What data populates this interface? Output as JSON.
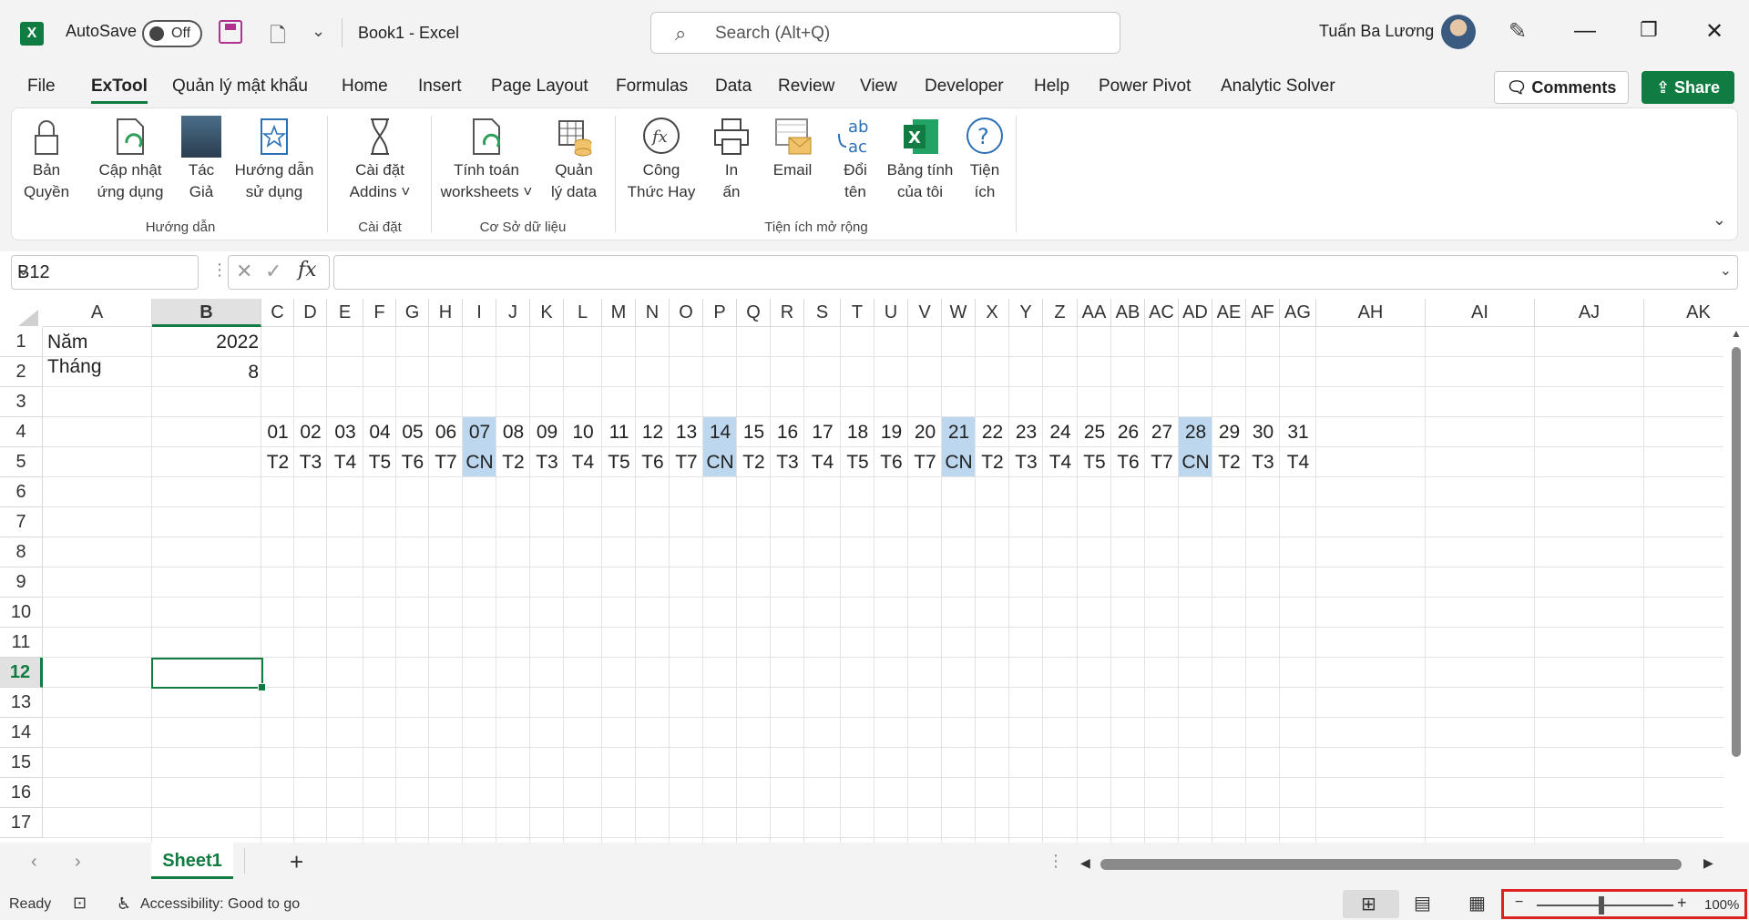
{
  "titlebar": {
    "autosave_label": "AutoSave",
    "autosave_state": "Off",
    "doc_title": "Book1  -  Excel",
    "search_placeholder": "Search (Alt+Q)",
    "user_name": "Tuấn Ba Lương"
  },
  "menu": {
    "items": [
      "File",
      "ExTool",
      "Quản lý mật khẩu",
      "Home",
      "Insert",
      "Page Layout",
      "Formulas",
      "Data",
      "Review",
      "View",
      "Developer",
      "Help",
      "Power Pivot",
      "Analytic Solver"
    ],
    "active": "ExTool",
    "comments_label": "Comments",
    "share_label": "Share"
  },
  "ribbon": {
    "groups": [
      {
        "label": "Hướng dẫn",
        "buttons": [
          {
            "line1": "Bản",
            "line2": "Quyền",
            "icon": "lock-icon"
          },
          {
            "line1": "Cập nhật",
            "line2": "ứng dụng",
            "icon": "update-icon"
          },
          {
            "line1": "Tác",
            "line2": "Giả",
            "icon": "author-photo-icon"
          },
          {
            "line1": "Hướng dẫn",
            "line2": "sử dụng",
            "icon": "guide-icon"
          }
        ]
      },
      {
        "label": "Cài đặt",
        "buttons": [
          {
            "line1": "Cài đặt",
            "line2": "Addins ˅",
            "icon": "hourglass-icon"
          }
        ]
      },
      {
        "label": "Cơ Sở dữ liệu",
        "buttons": [
          {
            "line1": "Tính toán",
            "line2": "worksheets ˅",
            "icon": "calc-sheet-icon"
          },
          {
            "line1": "Quản",
            "line2": "lý data",
            "icon": "database-icon"
          }
        ]
      },
      {
        "label": "Tiện ích mở rộng",
        "buttons": [
          {
            "line1": "Công",
            "line2": "Thức Hay",
            "icon": "fx-icon"
          },
          {
            "line1": "In",
            "line2": "ấn",
            "icon": "printer-icon"
          },
          {
            "line1": "Email",
            "line2": "",
            "icon": "email-icon"
          },
          {
            "line1": "Đổi",
            "line2": "tên",
            "icon": "rename-icon"
          },
          {
            "line1": "Bảng tính",
            "line2": "của tôi",
            "icon": "excel-icon"
          },
          {
            "line1": "Tiện",
            "line2": "ích",
            "icon": "help-icon"
          }
        ]
      }
    ]
  },
  "formula": {
    "name_box": "B12",
    "fx": "fx",
    "value": ""
  },
  "grid": {
    "columns": [
      "A",
      "B",
      "C",
      "D",
      "E",
      "F",
      "G",
      "H",
      "I",
      "J",
      "K",
      "L",
      "M",
      "N",
      "O",
      "P",
      "Q",
      "R",
      "S",
      "T",
      "U",
      "V",
      "W",
      "X",
      "Y",
      "Z",
      "AA",
      "AB",
      "AC",
      "AD",
      "AE",
      "AF",
      "AG",
      "AH",
      "AI",
      "AJ",
      "AK"
    ],
    "rows": [
      "1",
      "2",
      "3",
      "4",
      "5",
      "6",
      "7",
      "8",
      "9",
      "10",
      "11",
      "12",
      "13",
      "14",
      "15",
      "16",
      "17"
    ],
    "selected_col": "B",
    "selected_row": "12",
    "A1": "Năm",
    "B1": "2022",
    "A2": "Tháng",
    "B2": "8",
    "days": [
      "01",
      "02",
      "03",
      "04",
      "05",
      "06",
      "07",
      "08",
      "09",
      "10",
      "11",
      "12",
      "13",
      "14",
      "15",
      "16",
      "17",
      "18",
      "19",
      "20",
      "21",
      "22",
      "23",
      "24",
      "25",
      "26",
      "27",
      "28",
      "29",
      "30",
      "31"
    ],
    "weekdays": [
      "T2",
      "T3",
      "T4",
      "T5",
      "T6",
      "T7",
      "CN",
      "T2",
      "T3",
      "T4",
      "T5",
      "T6",
      "T7",
      "CN",
      "T2",
      "T3",
      "T4",
      "T5",
      "T6",
      "T7",
      "CN",
      "T2",
      "T3",
      "T4",
      "T5",
      "T6",
      "T7",
      "CN",
      "T2",
      "T3",
      "T4"
    ],
    "highlight_color": "#bdd7ee"
  },
  "tabs": {
    "sheet": "Sheet1",
    "add": "+"
  },
  "status": {
    "ready": "Ready",
    "accessibility": "Accessibility: Good to go",
    "zoom": "100%",
    "zoom_minus": "−",
    "zoom_plus": "+"
  }
}
